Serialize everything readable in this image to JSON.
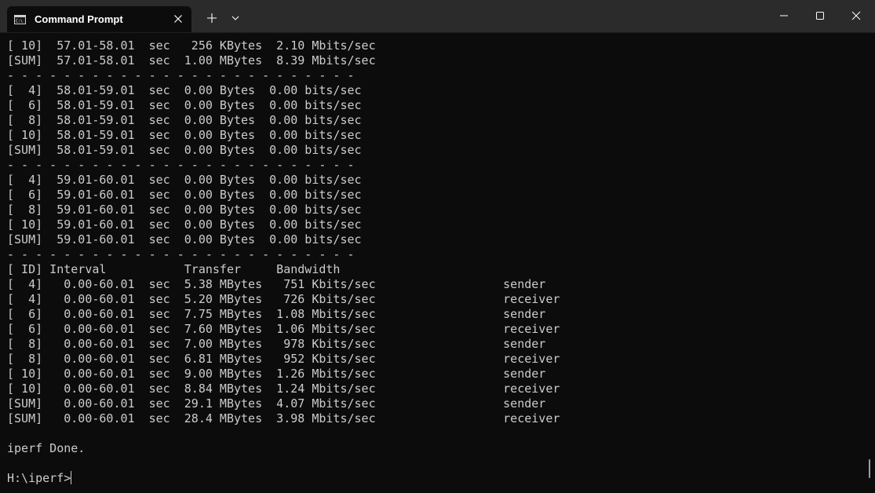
{
  "window": {
    "tab_title": "Command Prompt"
  },
  "icons": {
    "tab": "command-prompt-icon",
    "tab_close": "close-icon",
    "new_tab": "plus-icon",
    "dropdown": "chevron-down-icon",
    "minimize": "minimize-icon",
    "maximize": "maximize-icon",
    "close": "close-icon"
  },
  "colors": {
    "terminal_bg": "#0c0c0c",
    "terminal_fg": "#cccccc",
    "titlebar_bg": "#2b2b2b"
  },
  "console": {
    "lines": [
      "[ 10]  57.01-58.01  sec   256 KBytes  2.10 Mbits/sec",
      "[SUM]  57.01-58.01  sec  1.00 MBytes  8.39 Mbits/sec",
      "- - - - - - - - - - - - - - - - - - - - - - - - -",
      "[  4]  58.01-59.01  sec  0.00 Bytes  0.00 bits/sec",
      "[  6]  58.01-59.01  sec  0.00 Bytes  0.00 bits/sec",
      "[  8]  58.01-59.01  sec  0.00 Bytes  0.00 bits/sec",
      "[ 10]  58.01-59.01  sec  0.00 Bytes  0.00 bits/sec",
      "[SUM]  58.01-59.01  sec  0.00 Bytes  0.00 bits/sec",
      "- - - - - - - - - - - - - - - - - - - - - - - - -",
      "[  4]  59.01-60.01  sec  0.00 Bytes  0.00 bits/sec",
      "[  6]  59.01-60.01  sec  0.00 Bytes  0.00 bits/sec",
      "[  8]  59.01-60.01  sec  0.00 Bytes  0.00 bits/sec",
      "[ 10]  59.01-60.01  sec  0.00 Bytes  0.00 bits/sec",
      "[SUM]  59.01-60.01  sec  0.00 Bytes  0.00 bits/sec",
      "- - - - - - - - - - - - - - - - - - - - - - - - -",
      "[ ID] Interval           Transfer     Bandwidth",
      "[  4]   0.00-60.01  sec  5.38 MBytes   751 Kbits/sec                  sender",
      "[  4]   0.00-60.01  sec  5.20 MBytes   726 Kbits/sec                  receiver",
      "[  6]   0.00-60.01  sec  7.75 MBytes  1.08 Mbits/sec                  sender",
      "[  6]   0.00-60.01  sec  7.60 MBytes  1.06 Mbits/sec                  receiver",
      "[  8]   0.00-60.01  sec  7.00 MBytes   978 Kbits/sec                  sender",
      "[  8]   0.00-60.01  sec  6.81 MBytes   952 Kbits/sec                  receiver",
      "[ 10]   0.00-60.01  sec  9.00 MBytes  1.26 Mbits/sec                  sender",
      "[ 10]   0.00-60.01  sec  8.84 MBytes  1.24 Mbits/sec                  receiver",
      "[SUM]   0.00-60.01  sec  29.1 MBytes  4.07 Mbits/sec                  sender",
      "[SUM]   0.00-60.01  sec  28.4 MBytes  3.98 Mbits/sec                  receiver",
      "",
      "iperf Done.",
      ""
    ],
    "prompt": "H:\\iperf>"
  }
}
